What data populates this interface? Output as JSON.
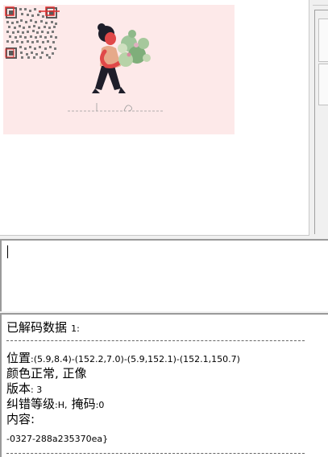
{
  "result": {
    "title_main": "已解码数据",
    "title_num": "1:",
    "position_label": "位置",
    "position_value": ":(5.9,8.4)-(152.2,7.0)-(5.9,152.1)-(152.1,150.7)",
    "color_status": "颜色正常, 正像",
    "version_label": "版本",
    "version_value": ": 3",
    "ecc_label": "纠错等级",
    "ecc_value": ":H,",
    "mask_label": "掩码",
    "mask_value": ":0",
    "content_label": "内容:",
    "content_value": "-0327-288a235370ea}"
  },
  "input": {
    "value": ""
  },
  "image": {
    "background": "#fde9e9",
    "accent": "#e03030"
  }
}
